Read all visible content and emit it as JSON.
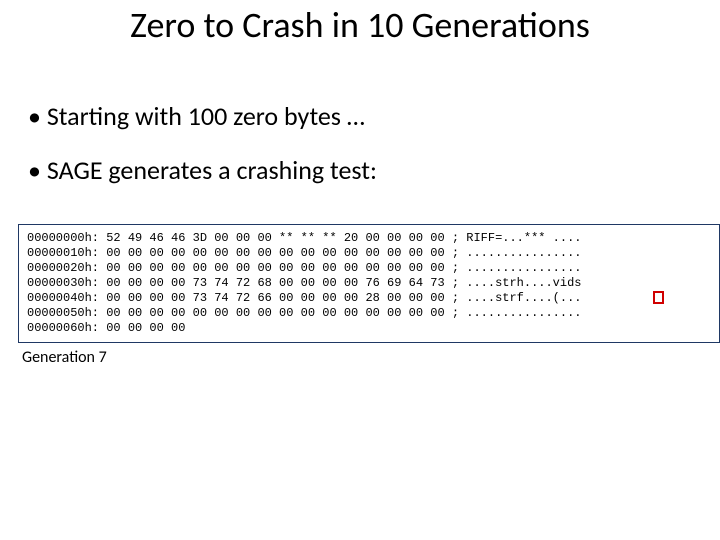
{
  "title": "Zero to Crash in 10 Generations",
  "bullet1": "Starting with 100 zero bytes …",
  "bullet2": "SAGE generates a crashing test:",
  "generation_label": "Generation 7",
  "hex_rows": [
    {
      "addr": "00000000h:",
      "bytes": "52 49 46 46 3D 00 00 00 ** ** ** 20 00 00 00 00",
      "ascii": "; RIFF=...*** ...."
    },
    {
      "addr": "00000010h:",
      "bytes": "00 00 00 00 00 00 00 00 00 00 00 00 00 00 00 00",
      "ascii": "; ................"
    },
    {
      "addr": "00000020h:",
      "bytes": "00 00 00 00 00 00 00 00 00 00 00 00 00 00 00 00",
      "ascii": "; ................"
    },
    {
      "addr": "00000030h:",
      "bytes": "00 00 00 00 73 74 72 68 00 00 00 00 76 69 64 73",
      "ascii": "; ....strh....vids"
    },
    {
      "addr": "00000040h:",
      "bytes": "00 00 00 00 73 74 72 66 00 00 00 00 28 00 00 00",
      "ascii": "; ....strf....(..."
    },
    {
      "addr": "00000050h:",
      "bytes": "00 00 00 00 00 00 00 00 00 00 00 00 00 00 00 00",
      "ascii": "; ................"
    },
    {
      "addr": "00000060h:",
      "bytes": "00 00 00 00",
      "ascii": "                                     ; ...."
    }
  ]
}
